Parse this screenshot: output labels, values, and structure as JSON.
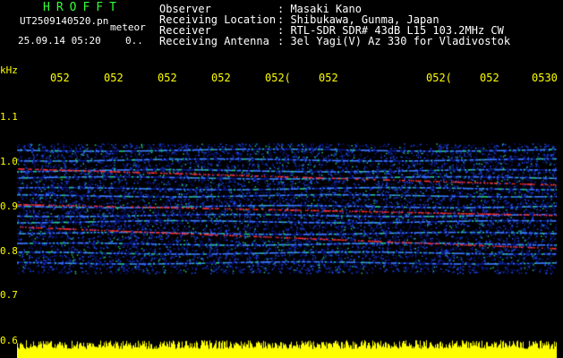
{
  "header": {
    "app_title": "HROFFT",
    "file_name": "UT2509140520.pn",
    "mode": "meteor",
    "date_time": "25.09.14 05:20",
    "counter": "0..",
    "info": [
      {
        "label": "Observer",
        "value": ": Masaki Kano"
      },
      {
        "label": "Receiving Location",
        "value": ": Shibukawa, Gunma, Japan"
      },
      {
        "label": "Receiver",
        "value": ": RTL-SDR SDR# 43dB L15 103.2MHz CW"
      },
      {
        "label": "Receiving Antenna",
        "value": ": 3el Yagi(V) Az 330 for Vladivostok"
      }
    ]
  },
  "spectrogram": {
    "y_unit": "kHz",
    "y_ticks": [
      "1.1",
      "1.0",
      "0.9",
      "0.8",
      "0.7",
      "0.6"
    ],
    "x_ticks": [
      "052",
      "052",
      "052",
      "052",
      "052(",
      "052",
      "052(",
      "052",
      "0530"
    ],
    "colors": {
      "background": "#000000",
      "labels": "#ffff00",
      "title": "#33ff33",
      "noise_floor": "#0a1a8c",
      "signal_mid": "#22cc88",
      "signal_strong": "#ff3030",
      "level_bar": "#ffff00"
    }
  }
}
